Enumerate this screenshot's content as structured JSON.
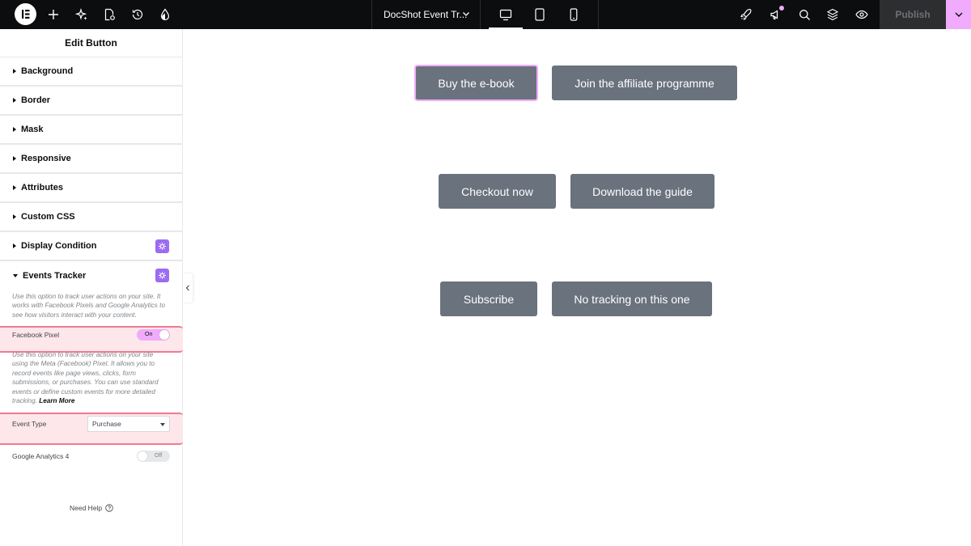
{
  "topbar": {
    "doc_title": "DocShot Event Tr...",
    "publish_label": "Publish",
    "icons": [
      "elementor-logo-icon",
      "add-icon",
      "ai-sparkle-icon",
      "page-settings-icon",
      "history-icon",
      "site-style-icon",
      "rocket-icon",
      "announcements-icon",
      "search-icon",
      "layers-icon",
      "preview-eye-icon"
    ],
    "devices": [
      "desktop",
      "tablet",
      "mobile"
    ],
    "active_device": "desktop",
    "accent": "#f0abfc"
  },
  "panel": {
    "title": "Edit Button",
    "sections": [
      {
        "label": "Background",
        "pro": false
      },
      {
        "label": "Border",
        "pro": false
      },
      {
        "label": "Mask",
        "pro": false
      },
      {
        "label": "Responsive",
        "pro": false
      },
      {
        "label": "Attributes",
        "pro": false
      },
      {
        "label": "Custom CSS",
        "pro": false
      },
      {
        "label": "Display Condition",
        "pro": true
      },
      {
        "label": "Events Tracker",
        "pro": true,
        "open": true
      }
    ],
    "events": {
      "intro": "Use this option to track user actions on your site. It works with Facebook Pixels and Google Analytics to see how visitors interact with your content.",
      "facebook_label": "Facebook Pixel",
      "facebook_state": "On",
      "facebook_desc": "Use this option to track user actions on your site using the Meta (Facebook) Pixel. It allows you to record events like page views, clicks, form submissions, or purchases. You can use standard events or define custom events for more detailed tracking.",
      "learn_more": "Learn More",
      "event_type_label": "Event Type",
      "event_type_value": "Purchase",
      "ga_label": "Google Analytics 4",
      "ga_state": "Off"
    },
    "help": "Need Help"
  },
  "canvas": {
    "buttons": [
      {
        "label": "Buy the e-book",
        "selected": true
      },
      {
        "label": "Join the affiliate programme",
        "selected": false
      },
      {
        "label": "Checkout now",
        "selected": false
      },
      {
        "label": "Download the guide",
        "selected": false
      },
      {
        "label": "Subscribe",
        "selected": false
      },
      {
        "label": "No tracking on this one",
        "selected": false
      }
    ],
    "button_color": "#69727d"
  }
}
